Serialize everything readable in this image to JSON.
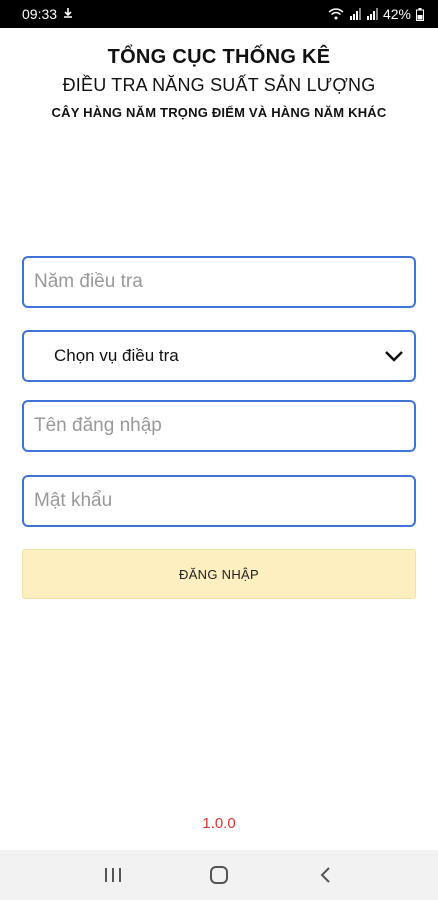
{
  "status_bar": {
    "time": "09:33",
    "battery": "42%",
    "icons": [
      "download-icon",
      "wifi-icon",
      "signal-icon",
      "signal-icon",
      "battery-icon"
    ]
  },
  "header": {
    "title": "TỔNG CỤC THỐNG KÊ",
    "subtitle": "ĐIỀU TRA NĂNG SUẤT SẢN LƯỢNG",
    "subtitle2": "CÂY HÀNG NĂM TRỌNG ĐIỂM VÀ HÀNG NĂM KHÁC"
  },
  "form": {
    "year_placeholder": "Năm điều tra",
    "season_selected": "Chọn vụ điều tra",
    "username_placeholder": "Tên đăng nhập",
    "password_placeholder": "Mật khẩu",
    "login_label": "ĐĂNG NHẬP"
  },
  "footer": {
    "version": "1.0.0"
  },
  "nav_bar": {
    "icons": [
      "recent-apps-icon",
      "home-icon",
      "back-icon"
    ]
  },
  "colors": {
    "accent": "#3f73d6",
    "button_bg": "#fdefbf",
    "version_red": "#dd3333"
  }
}
